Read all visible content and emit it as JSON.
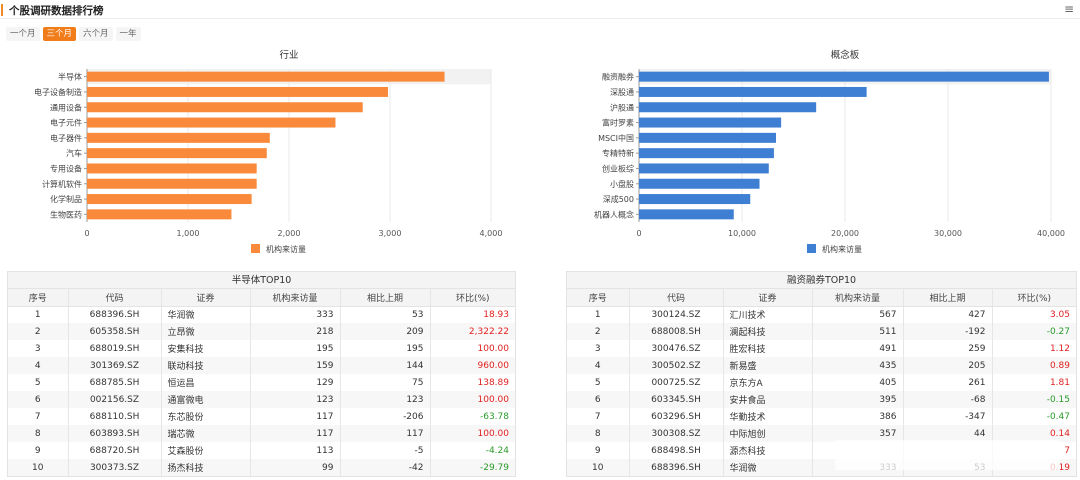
{
  "header": {
    "title": "个股调研数据排行榜",
    "menu_icon": "≡"
  },
  "tabs": [
    {
      "label": "一个月",
      "active": false
    },
    {
      "label": "三个月",
      "active": true
    },
    {
      "label": "六个月",
      "active": false
    },
    {
      "label": "一年",
      "active": false
    }
  ],
  "colors": {
    "accent": "#f07c1a",
    "industry_bar": "#f98a3b",
    "concept_bar": "#3f7fd3",
    "up": "#e02020",
    "down": "#2a9a2a"
  },
  "chart_data": [
    {
      "type": "bar",
      "orientation": "horizontal",
      "title": "行业",
      "categories": [
        "半导体",
        "电子设备制造",
        "通用设备",
        "电子元件",
        "电子器件",
        "汽车",
        "专用设备",
        "计算机软件",
        "化学制品",
        "生物医药"
      ],
      "series": [
        {
          "name": "机构来访量",
          "values": [
            3540,
            2980,
            2730,
            2460,
            1810,
            1780,
            1680,
            1680,
            1630,
            1430
          ]
        }
      ],
      "xlim": [
        0,
        4000
      ],
      "xticks": [
        "0",
        "1,000",
        "2,000",
        "3,000",
        "4,000"
      ],
      "legend": "bottom-center",
      "grid": true
    },
    {
      "type": "bar",
      "orientation": "horizontal",
      "title": "概念板",
      "categories": [
        "融资融券",
        "深股通",
        "沪股通",
        "富时罗素",
        "MSCI中国",
        "专精特新",
        "创业板综",
        "小盘股",
        "深成500",
        "机器人概念"
      ],
      "series": [
        {
          "name": "机构来访量",
          "values": [
            39800,
            22100,
            17200,
            13800,
            13300,
            13100,
            12600,
            11700,
            10800,
            9200
          ]
        }
      ],
      "xlim": [
        0,
        40000
      ],
      "xticks": [
        "0",
        "10,000",
        "20,000",
        "30,000",
        "40,000"
      ],
      "legend": "bottom-center",
      "grid": true
    }
  ],
  "tables": [
    {
      "title": "半导体TOP10",
      "columns": [
        "序号",
        "代码",
        "证券",
        "机构来访量",
        "相比上期",
        "环比(%)"
      ],
      "rows": [
        [
          "1",
          "688396.SH",
          "华润微",
          "333",
          "53",
          "18.93"
        ],
        [
          "2",
          "605358.SH",
          "立昂微",
          "218",
          "209",
          "2,322.22"
        ],
        [
          "3",
          "688019.SH",
          "安集科技",
          "195",
          "195",
          "100.00"
        ],
        [
          "4",
          "301369.SZ",
          "联动科技",
          "159",
          "144",
          "960.00"
        ],
        [
          "5",
          "688785.SH",
          "恒运昌",
          "129",
          "75",
          "138.89"
        ],
        [
          "6",
          "002156.SZ",
          "通富微电",
          "123",
          "123",
          "100.00"
        ],
        [
          "7",
          "688110.SH",
          "东芯股份",
          "117",
          "-206",
          "-63.78"
        ],
        [
          "8",
          "603893.SH",
          "瑞芯微",
          "117",
          "117",
          "100.00"
        ],
        [
          "9",
          "688720.SH",
          "艾森股份",
          "113",
          "-5",
          "-4.24"
        ],
        [
          "10",
          "300373.SZ",
          "扬杰科技",
          "99",
          "-42",
          "-29.79"
        ]
      ]
    },
    {
      "title": "融资融券TOP10",
      "columns": [
        "序号",
        "代码",
        "证券",
        "机构来访量",
        "相比上期",
        "环比(%)"
      ],
      "rows": [
        [
          "1",
          "300124.SZ",
          "汇川技术",
          "567",
          "427",
          "3.05"
        ],
        [
          "2",
          "688008.SH",
          "澜起科技",
          "511",
          "-192",
          "-0.27"
        ],
        [
          "3",
          "300476.SZ",
          "胜宏科技",
          "491",
          "259",
          "1.12"
        ],
        [
          "4",
          "300502.SZ",
          "新易盛",
          "435",
          "205",
          "0.89"
        ],
        [
          "5",
          "000725.SZ",
          "京东方A",
          "405",
          "261",
          "1.81"
        ],
        [
          "6",
          "603345.SH",
          "安井食品",
          "395",
          "-68",
          "-0.15"
        ],
        [
          "7",
          "603296.SH",
          "华勤技术",
          "386",
          "-347",
          "-0.47"
        ],
        [
          "8",
          "300308.SZ",
          "中际旭创",
          "357",
          "44",
          "0.14"
        ],
        [
          "9",
          "688498.SH",
          "源杰科技",
          "",
          "",
          "7"
        ],
        [
          "10",
          "688396.SH",
          "华润微",
          "333",
          "53",
          "0.19"
        ]
      ]
    }
  ]
}
